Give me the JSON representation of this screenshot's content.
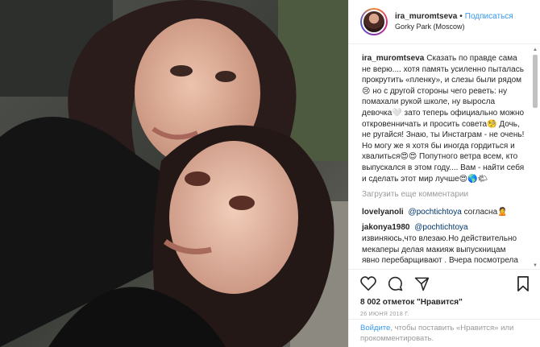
{
  "post": {
    "username": "ira_muromtseva",
    "separator": "•",
    "follow_label": "Подписаться",
    "location": "Gorky Park (Moscow)"
  },
  "caption": {
    "username": "ira_muromtseva",
    "text": "Сказать по правде сама не верю.... хотя память усиленно пыталась прокрутить «пленку», и слезы были рядом😢 но с другой стороны чего реветь: ну помахали рукой школе, ну выросла девочка🤍 зато теперь официально можно откровенничать и просить совета🧐 Дочь, не ругайся! Знаю, ты Инстаграм - не очень! Но могу же я хотя бы иногда гордиться и хвалиться😍😍 Попутного ветра всем, кто выпускался в этом году.... Вам - найти себя и сделать этот мир лучше😍🌎🌤"
  },
  "load_more_label": "Загрузить еще комментарии",
  "comments": [
    {
      "username": "lovelyanoli",
      "mention": "@pochtichtoya",
      "text": "согласна🙎"
    },
    {
      "username": "jakonya1980",
      "mention": "@pochtichtoya",
      "text": "извиняюсь,что влезаю.Но действительно мекаперы делая макияж выпускницам явно перебарщивают . Вчера посмотрела"
    }
  ],
  "icons": [
    "heart-icon",
    "comment-icon",
    "share-icon",
    "bookmark-icon"
  ],
  "likes_label": "8 002 отметок \"Нравится\"",
  "date_label": "26 ИЮНЯ 2018 Г.",
  "login": {
    "link_label": "Войдите",
    "text": ", чтобы поставить «Нравится» или прокомментировать."
  },
  "colors": {
    "accent": "#3897f0",
    "muted": "#999999",
    "text": "#262626"
  }
}
